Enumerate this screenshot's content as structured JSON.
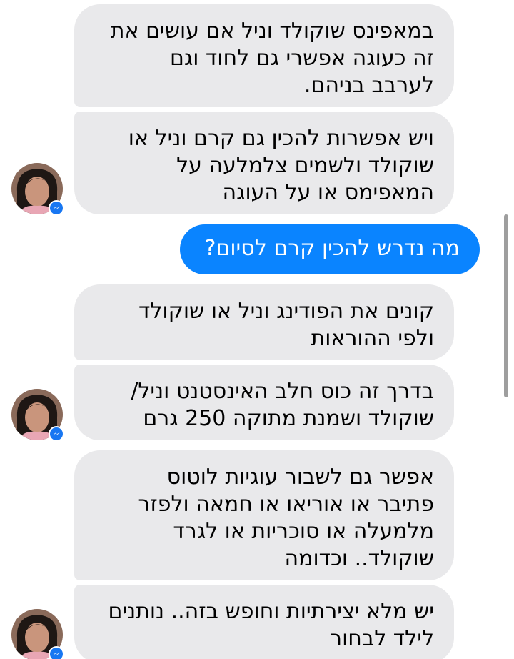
{
  "messages": [
    {
      "sender": "contact",
      "text": "במאפינס שוקולד וניל אם עושים את\nזה כעוגה אפשרי גם לחוד וגם\nלערבב בניהם."
    },
    {
      "sender": "contact",
      "text": "ויש אפשרות להכין גם קרם וניל או\nשוקולד ולשמים צלמלעה על\nהמאפימס או על העוגה"
    },
    {
      "sender": "me",
      "text": "מה נדרש להכין קרם לסיום?"
    },
    {
      "sender": "contact",
      "text": "קונים את הפודינג וניל או שוקולד\nולפי ההוראות"
    },
    {
      "sender": "contact",
      "text": "בדרך זה כוס חלב האינסטנט וניל/\nשוקולד ושמנת מתוקה 250 גרם"
    },
    {
      "sender": "contact",
      "text": "אפשר גם לשבור עוגיות לוטוס\nפתיבר או אוריאו או חמאה ולפזר\nמלמעלה או סוכריות או לגרד\nשוקולד.. וכדומה"
    },
    {
      "sender": "contact",
      "text": "יש מלא יצירתיות וחופש בזה.. נותנים\nלילד לבחור"
    }
  ],
  "icons": {
    "avatar": "contact-avatar",
    "badge": "messenger-badge-icon"
  },
  "colors": {
    "incoming_bubble": "#e9e9eb",
    "outgoing_bubble": "#0a84ff",
    "badge": "#1877f2"
  }
}
